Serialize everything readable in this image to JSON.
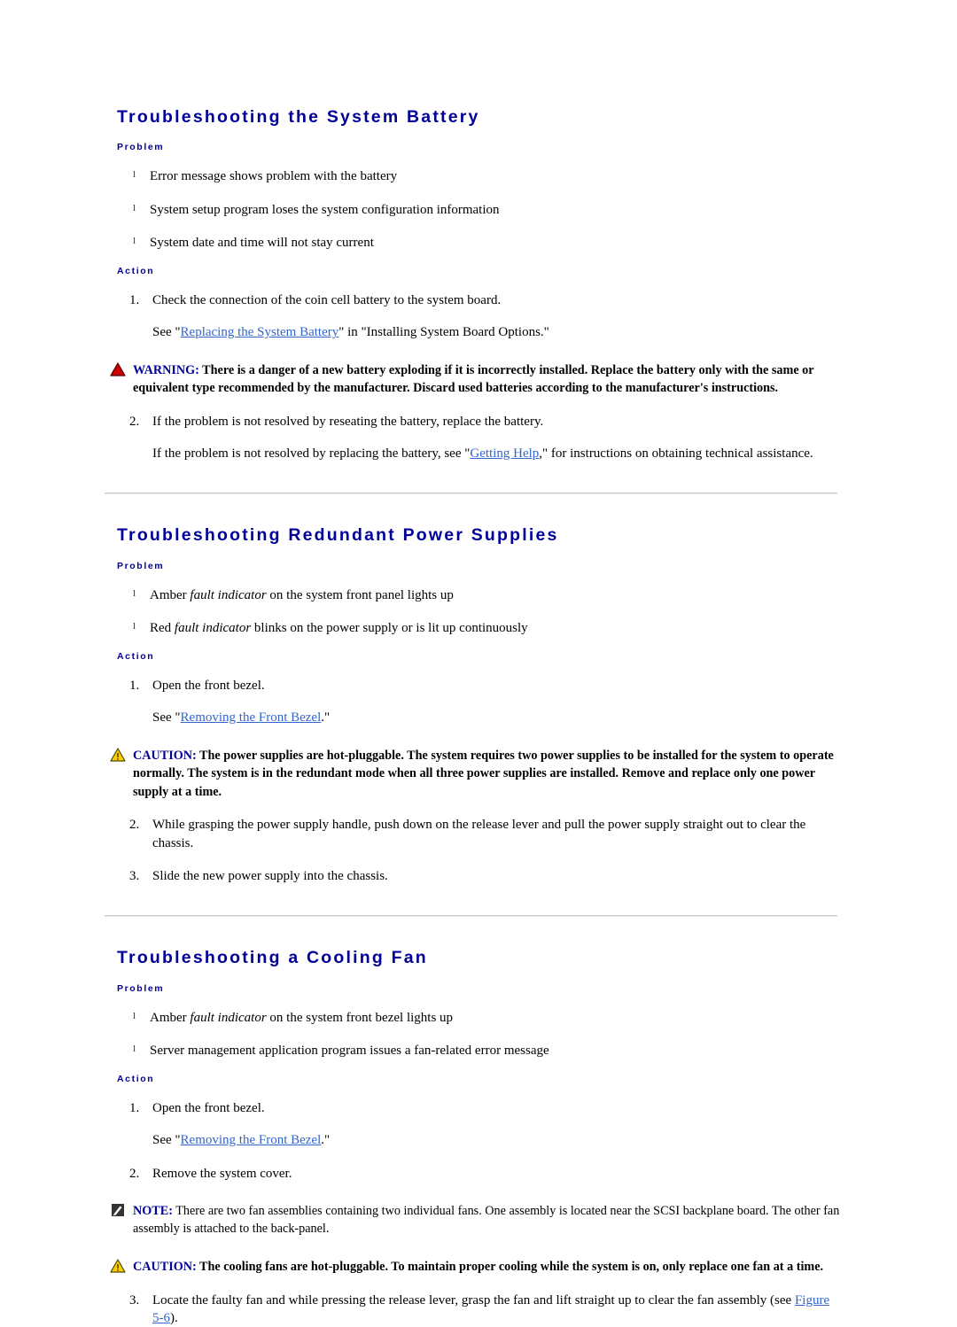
{
  "document": {
    "link_color": "#3366cc",
    "heading_color": "#000099",
    "warning_icon_color": "#cc0000",
    "caution_icon_color": "#ffcc00",
    "note_icon_color": "#333333",
    "separator_color": "#cccccc"
  },
  "sections": [
    {
      "title": "Troubleshooting the System Battery",
      "problem_label": "Problem",
      "action_label": "Action",
      "problems": [
        "Error message shows problem with the battery",
        "System setup program loses the system configuration information",
        "System date and time will not stay current"
      ],
      "steps": {
        "s1_num": "1.",
        "s1_text": "Check the connection of the coin cell battery to the system board.",
        "s1_see_prefix": "See \"",
        "s1_see_link": "Replacing the System Battery",
        "s1_see_suffix": "\" in \"Installing System Board Options.\"",
        "s2_num": "2.",
        "s2_text": "If the problem is not resolved by reseating the battery, replace the battery.",
        "s2_see_prefix": "If the problem is not resolved by replacing the battery, see \"",
        "s2_see_link": "Getting Help",
        "s2_see_suffix": ",\" for instructions on obtaining technical assistance."
      },
      "warning": {
        "icon": "warning-triangle-icon",
        "label": "WARNING:",
        "text": " There is a danger of a new battery exploding if it is incorrectly installed. Replace the battery only with the same or equivalent type recommended by the manufacturer. Discard used batteries according to the manufacturer's instructions."
      }
    },
    {
      "title": "Troubleshooting Redundant Power Supplies",
      "problem_label": "Problem",
      "action_label": "Action",
      "problems_rich": [
        {
          "pre": "Amber ",
          "em": "fault indicator",
          "post": " on the system front panel lights up"
        },
        {
          "pre": "Red ",
          "em": "fault indicator",
          "post": " blinks on the power supply or is lit up continuously"
        }
      ],
      "steps": {
        "s1_num": "1.",
        "s1_text": "Open the front bezel.",
        "s1_see_prefix": "See \"",
        "s1_see_link": "Removing the Front Bezel",
        "s1_see_suffix": ".\"",
        "s2_num": "2.",
        "s2_text": "While grasping the power supply handle, push down on the release lever and pull the power supply straight out to clear the chassis.",
        "s3_num": "3.",
        "s3_text": "Slide the new power supply into the chassis."
      },
      "caution": {
        "icon": "caution-triangle-icon",
        "label": "CAUTION:",
        "text": " The power supplies are hot-pluggable. The system requires two power supplies to be installed for the system to operate normally. The system is in the redundant mode when all three power supplies are installed. Remove and replace only one power supply at a time."
      }
    },
    {
      "title": "Troubleshooting a Cooling Fan",
      "problem_label": "Problem",
      "action_label": "Action",
      "problems_rich": [
        {
          "pre": "Amber ",
          "em": "fault indicator",
          "post": " on the system front bezel lights up"
        },
        {
          "pre": "Server management application program issues a fan-related error message",
          "em": "",
          "post": ""
        }
      ],
      "steps": {
        "s1_num": "1.",
        "s1_text": "Open the front bezel.",
        "s1_see_prefix": "See \"",
        "s1_see_link": "Removing the Front Bezel",
        "s1_see_suffix": ".\"",
        "s2_num": "2.",
        "s2_text": "Remove the system cover.",
        "s3_num": "3.",
        "s3_prefix": "Locate the faulty fan and while pressing the release lever, grasp the fan and lift straight up to clear the fan assembly (see ",
        "s3_link": "Figure 5-6",
        "s3_suffix": ")."
      },
      "note": {
        "icon": "note-pencil-icon",
        "label": "NOTE:",
        "text": " There are two fan assemblies containing two individual fans. One assembly is located near the SCSI backplane board. The other fan assembly is attached to the back-panel."
      },
      "caution": {
        "icon": "caution-triangle-icon",
        "label": "CAUTION:",
        "text": " The cooling fans are hot-pluggable. To maintain proper cooling while the system is on, only replace one fan at a time."
      }
    }
  ],
  "glyphs": {
    "bullet_tick": "l"
  }
}
